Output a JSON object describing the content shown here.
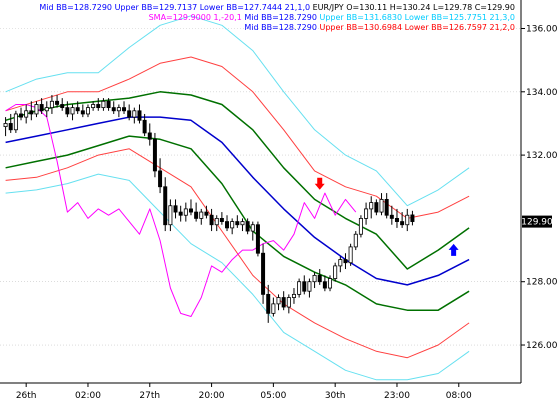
{
  "chart_data": {
    "type": "line",
    "symbol": "EUR/JPY",
    "legend_lines": [
      {
        "text": "Mid BB=128.7290 Upper BB=129.7137 Lower BB=127.7444   21,1,0",
        "color": "#0000ff"
      },
      {
        "text": "EUR/JPY O=130.11 H=130.24 L=129.78 C=129.90",
        "color": "#000000"
      },
      {
        "text": "SMA=129.9000   1,-20,1",
        "color": "#ff00ff"
      },
      {
        "text": "Mid BB=128.7290",
        "color": "#0000ff"
      },
      {
        "text": "Upper BB=131.6830 Lower BB=125.7751   21,3,0",
        "color": "#00ccff"
      },
      {
        "text": "Mid BB=128.7290",
        "color": "#0000ff"
      },
      {
        "text": "Upper BB=130.6984 Lower BB=126.7597   21,2,0",
        "color": "#ff0000"
      }
    ],
    "y_ticks": [
      "136.00",
      "134.00",
      "132.00",
      "128.00",
      "126.00"
    ],
    "ylim": [
      124.8,
      136.9
    ],
    "current_price": "129.90",
    "x_ticks": [
      {
        "label": "26th",
        "i": 4
      },
      {
        "label": "02:00",
        "i": 16
      },
      {
        "label": "27th",
        "i": 28
      },
      {
        "label": "20:00",
        "i": 40
      },
      {
        "label": "05:00",
        "i": 52
      },
      {
        "label": "30th",
        "i": 64
      },
      {
        "label": "23:00",
        "i": 76
      },
      {
        "label": "08:00",
        "i": 88
      }
    ],
    "n_slots": 100,
    "ohlc": [
      {
        "i": 0,
        "o": 132.9,
        "h": 133.2,
        "l": 132.6,
        "c": 133.0
      },
      {
        "i": 1,
        "o": 133.0,
        "h": 133.3,
        "l": 132.7,
        "c": 132.8
      },
      {
        "i": 2,
        "o": 132.8,
        "h": 133.4,
        "l": 132.7,
        "c": 133.3
      },
      {
        "i": 3,
        "o": 133.3,
        "h": 133.5,
        "l": 133.1,
        "c": 133.2
      },
      {
        "i": 4,
        "o": 133.2,
        "h": 133.6,
        "l": 133.0,
        "c": 133.4
      },
      {
        "i": 5,
        "o": 133.4,
        "h": 133.7,
        "l": 133.1,
        "c": 133.3
      },
      {
        "i": 6,
        "o": 133.3,
        "h": 133.7,
        "l": 133.2,
        "c": 133.6
      },
      {
        "i": 7,
        "o": 133.6,
        "h": 133.8,
        "l": 133.3,
        "c": 133.4
      },
      {
        "i": 8,
        "o": 133.4,
        "h": 133.7,
        "l": 133.2,
        "c": 133.5
      },
      {
        "i": 9,
        "o": 133.5,
        "h": 133.9,
        "l": 133.3,
        "c": 133.7
      },
      {
        "i": 10,
        "o": 133.7,
        "h": 133.9,
        "l": 133.5,
        "c": 133.6
      },
      {
        "i": 11,
        "o": 133.6,
        "h": 133.8,
        "l": 133.4,
        "c": 133.5
      },
      {
        "i": 12,
        "o": 133.5,
        "h": 133.7,
        "l": 133.2,
        "c": 133.3
      },
      {
        "i": 13,
        "o": 133.3,
        "h": 133.6,
        "l": 133.1,
        "c": 133.5
      },
      {
        "i": 14,
        "o": 133.5,
        "h": 133.7,
        "l": 133.3,
        "c": 133.4
      },
      {
        "i": 15,
        "o": 133.4,
        "h": 133.6,
        "l": 133.2,
        "c": 133.3
      },
      {
        "i": 16,
        "o": 133.3,
        "h": 133.6,
        "l": 133.2,
        "c": 133.5
      },
      {
        "i": 17,
        "o": 133.5,
        "h": 133.7,
        "l": 133.4,
        "c": 133.6
      },
      {
        "i": 18,
        "o": 133.6,
        "h": 133.8,
        "l": 133.4,
        "c": 133.5
      },
      {
        "i": 19,
        "o": 133.5,
        "h": 133.8,
        "l": 133.4,
        "c": 133.7
      },
      {
        "i": 20,
        "o": 133.7,
        "h": 133.8,
        "l": 133.4,
        "c": 133.5
      },
      {
        "i": 21,
        "o": 133.5,
        "h": 133.7,
        "l": 133.3,
        "c": 133.4
      },
      {
        "i": 22,
        "o": 133.4,
        "h": 133.6,
        "l": 133.2,
        "c": 133.5
      },
      {
        "i": 23,
        "o": 133.5,
        "h": 133.7,
        "l": 133.3,
        "c": 133.4
      },
      {
        "i": 24,
        "o": 133.4,
        "h": 133.6,
        "l": 133.1,
        "c": 133.2
      },
      {
        "i": 25,
        "o": 133.2,
        "h": 133.5,
        "l": 133.0,
        "c": 133.4
      },
      {
        "i": 26,
        "o": 133.4,
        "h": 133.6,
        "l": 133.0,
        "c": 133.1
      },
      {
        "i": 27,
        "o": 133.1,
        "h": 133.3,
        "l": 132.6,
        "c": 132.7
      },
      {
        "i": 28,
        "o": 132.7,
        "h": 133.0,
        "l": 132.3,
        "c": 132.5
      },
      {
        "i": 29,
        "o": 132.5,
        "h": 132.7,
        "l": 131.3,
        "c": 131.5
      },
      {
        "i": 30,
        "o": 131.5,
        "h": 131.9,
        "l": 130.8,
        "c": 131.0
      },
      {
        "i": 31,
        "o": 131.0,
        "h": 131.3,
        "l": 129.6,
        "c": 129.8
      },
      {
        "i": 32,
        "o": 129.8,
        "h": 130.6,
        "l": 129.6,
        "c": 130.4
      },
      {
        "i": 33,
        "o": 130.4,
        "h": 130.6,
        "l": 130.0,
        "c": 130.2
      },
      {
        "i": 34,
        "o": 130.2,
        "h": 130.4,
        "l": 129.9,
        "c": 130.1
      },
      {
        "i": 35,
        "o": 130.1,
        "h": 130.5,
        "l": 129.9,
        "c": 130.3
      },
      {
        "i": 36,
        "o": 130.3,
        "h": 130.6,
        "l": 130.1,
        "c": 130.2
      },
      {
        "i": 37,
        "o": 130.2,
        "h": 130.5,
        "l": 129.9,
        "c": 130.0
      },
      {
        "i": 38,
        "o": 130.0,
        "h": 130.3,
        "l": 129.8,
        "c": 130.2
      },
      {
        "i": 39,
        "o": 130.2,
        "h": 130.4,
        "l": 130.0,
        "c": 130.1
      },
      {
        "i": 40,
        "o": 130.1,
        "h": 130.3,
        "l": 129.6,
        "c": 129.8
      },
      {
        "i": 41,
        "o": 129.8,
        "h": 130.1,
        "l": 129.6,
        "c": 130.0
      },
      {
        "i": 42,
        "o": 130.0,
        "h": 130.2,
        "l": 129.8,
        "c": 129.9
      },
      {
        "i": 43,
        "o": 129.9,
        "h": 130.1,
        "l": 129.6,
        "c": 129.7
      },
      {
        "i": 44,
        "o": 129.7,
        "h": 130.0,
        "l": 129.5,
        "c": 129.9
      },
      {
        "i": 45,
        "o": 129.9,
        "h": 130.1,
        "l": 129.7,
        "c": 129.8
      },
      {
        "i": 46,
        "o": 129.8,
        "h": 130.0,
        "l": 129.6,
        "c": 129.9
      },
      {
        "i": 47,
        "o": 129.9,
        "h": 130.0,
        "l": 129.5,
        "c": 129.6
      },
      {
        "i": 48,
        "o": 129.6,
        "h": 129.9,
        "l": 129.3,
        "c": 129.8
      },
      {
        "i": 49,
        "o": 129.8,
        "h": 129.9,
        "l": 128.8,
        "c": 128.9
      },
      {
        "i": 50,
        "o": 128.9,
        "h": 129.2,
        "l": 127.3,
        "c": 127.6
      },
      {
        "i": 51,
        "o": 127.6,
        "h": 127.9,
        "l": 126.7,
        "c": 127.0
      },
      {
        "i": 52,
        "o": 127.0,
        "h": 127.5,
        "l": 126.9,
        "c": 127.3
      },
      {
        "i": 53,
        "o": 127.3,
        "h": 127.6,
        "l": 127.1,
        "c": 127.5
      },
      {
        "i": 54,
        "o": 127.5,
        "h": 127.7,
        "l": 127.1,
        "c": 127.2
      },
      {
        "i": 55,
        "o": 127.2,
        "h": 127.6,
        "l": 127.0,
        "c": 127.5
      },
      {
        "i": 56,
        "o": 127.5,
        "h": 127.8,
        "l": 127.3,
        "c": 127.6
      },
      {
        "i": 57,
        "o": 127.6,
        "h": 128.1,
        "l": 127.5,
        "c": 128.0
      },
      {
        "i": 58,
        "o": 128.0,
        "h": 128.2,
        "l": 127.6,
        "c": 127.7
      },
      {
        "i": 59,
        "o": 127.7,
        "h": 128.1,
        "l": 127.5,
        "c": 128.0
      },
      {
        "i": 60,
        "o": 128.0,
        "h": 128.3,
        "l": 127.8,
        "c": 128.2
      },
      {
        "i": 61,
        "o": 128.2,
        "h": 128.4,
        "l": 127.9,
        "c": 128.0
      },
      {
        "i": 62,
        "o": 128.0,
        "h": 128.2,
        "l": 127.7,
        "c": 127.8
      },
      {
        "i": 63,
        "o": 127.8,
        "h": 128.2,
        "l": 127.7,
        "c": 128.1
      },
      {
        "i": 64,
        "o": 128.1,
        "h": 128.6,
        "l": 128.0,
        "c": 128.5
      },
      {
        "i": 65,
        "o": 128.5,
        "h": 128.8,
        "l": 128.3,
        "c": 128.7
      },
      {
        "i": 66,
        "o": 128.7,
        "h": 128.9,
        "l": 128.4,
        "c": 128.6
      },
      {
        "i": 67,
        "o": 128.6,
        "h": 129.2,
        "l": 128.5,
        "c": 129.1
      },
      {
        "i": 68,
        "o": 129.1,
        "h": 129.6,
        "l": 129.0,
        "c": 129.5
      },
      {
        "i": 69,
        "o": 129.5,
        "h": 130.1,
        "l": 129.4,
        "c": 130.0
      },
      {
        "i": 70,
        "o": 130.0,
        "h": 130.5,
        "l": 129.8,
        "c": 130.3
      },
      {
        "i": 71,
        "o": 130.3,
        "h": 130.7,
        "l": 130.0,
        "c": 130.5
      },
      {
        "i": 72,
        "o": 130.5,
        "h": 130.6,
        "l": 130.1,
        "c": 130.2
      },
      {
        "i": 73,
        "o": 130.2,
        "h": 130.8,
        "l": 130.1,
        "c": 130.6
      },
      {
        "i": 74,
        "o": 130.6,
        "h": 130.8,
        "l": 130.0,
        "c": 130.1
      },
      {
        "i": 75,
        "o": 130.1,
        "h": 130.4,
        "l": 129.8,
        "c": 130.0
      },
      {
        "i": 76,
        "o": 130.0,
        "h": 130.3,
        "l": 129.7,
        "c": 129.9
      },
      {
        "i": 77,
        "o": 129.9,
        "h": 130.2,
        "l": 129.7,
        "c": 129.8
      },
      {
        "i": 78,
        "o": 129.8,
        "h": 130.3,
        "l": 129.6,
        "c": 130.1
      },
      {
        "i": 79,
        "o": 130.11,
        "h": 130.24,
        "l": 129.78,
        "c": 129.9
      }
    ],
    "sma": [
      {
        "i": 0,
        "v": 133.4
      },
      {
        "i": 2,
        "v": 133.6
      },
      {
        "i": 4,
        "v": 133.6
      },
      {
        "i": 6,
        "v": 133.5
      },
      {
        "i": 8,
        "v": 133.2
      },
      {
        "i": 10,
        "v": 131.8
      },
      {
        "i": 12,
        "v": 130.2
      },
      {
        "i": 14,
        "v": 130.5
      },
      {
        "i": 16,
        "v": 130.0
      },
      {
        "i": 18,
        "v": 130.3
      },
      {
        "i": 20,
        "v": 130.1
      },
      {
        "i": 22,
        "v": 130.3
      },
      {
        "i": 24,
        "v": 129.9
      },
      {
        "i": 26,
        "v": 129.5
      },
      {
        "i": 28,
        "v": 130.3
      },
      {
        "i": 30,
        "v": 129.3
      },
      {
        "i": 32,
        "v": 127.8
      },
      {
        "i": 34,
        "v": 127.0
      },
      {
        "i": 36,
        "v": 126.9
      },
      {
        "i": 38,
        "v": 127.5
      },
      {
        "i": 40,
        "v": 128.5
      },
      {
        "i": 42,
        "v": 128.3
      },
      {
        "i": 44,
        "v": 128.7
      },
      {
        "i": 46,
        "v": 129.0
      },
      {
        "i": 48,
        "v": 129.0
      },
      {
        "i": 50,
        "v": 129.2
      },
      {
        "i": 52,
        "v": 129.3
      },
      {
        "i": 54,
        "v": 129.0
      },
      {
        "i": 56,
        "v": 129.5
      },
      {
        "i": 58,
        "v": 130.5
      },
      {
        "i": 60,
        "v": 130.0
      },
      {
        "i": 62,
        "v": 130.8
      },
      {
        "i": 64,
        "v": 130.1
      },
      {
        "i": 66,
        "v": 130.6
      },
      {
        "i": 68,
        "v": 130.2
      }
    ],
    "mid_bb": [
      {
        "i": 0,
        "v": 132.4
      },
      {
        "i": 6,
        "v": 132.6
      },
      {
        "i": 12,
        "v": 132.8
      },
      {
        "i": 18,
        "v": 133.0
      },
      {
        "i": 24,
        "v": 133.2
      },
      {
        "i": 30,
        "v": 133.2
      },
      {
        "i": 36,
        "v": 133.1
      },
      {
        "i": 42,
        "v": 132.4
      },
      {
        "i": 48,
        "v": 131.3
      },
      {
        "i": 54,
        "v": 130.3
      },
      {
        "i": 60,
        "v": 129.4
      },
      {
        "i": 66,
        "v": 128.7
      },
      {
        "i": 72,
        "v": 128.1
      },
      {
        "i": 78,
        "v": 127.9
      },
      {
        "i": 84,
        "v": 128.2
      },
      {
        "i": 90,
        "v": 128.7
      }
    ],
    "green_upper": [
      {
        "i": 0,
        "v": 133.1
      },
      {
        "i": 6,
        "v": 133.4
      },
      {
        "i": 12,
        "v": 133.6
      },
      {
        "i": 18,
        "v": 133.7
      },
      {
        "i": 24,
        "v": 133.8
      },
      {
        "i": 30,
        "v": 134.0
      },
      {
        "i": 36,
        "v": 133.9
      },
      {
        "i": 42,
        "v": 133.6
      },
      {
        "i": 48,
        "v": 132.8
      },
      {
        "i": 54,
        "v": 131.6
      },
      {
        "i": 60,
        "v": 130.6
      },
      {
        "i": 66,
        "v": 130.0
      },
      {
        "i": 72,
        "v": 129.5
      },
      {
        "i": 78,
        "v": 128.4
      },
      {
        "i": 84,
        "v": 129.0
      },
      {
        "i": 90,
        "v": 129.7
      }
    ],
    "green_lower": [
      {
        "i": 0,
        "v": 131.6
      },
      {
        "i": 6,
        "v": 131.8
      },
      {
        "i": 12,
        "v": 132.0
      },
      {
        "i": 18,
        "v": 132.3
      },
      {
        "i": 24,
        "v": 132.6
      },
      {
        "i": 30,
        "v": 132.5
      },
      {
        "i": 36,
        "v": 132.2
      },
      {
        "i": 42,
        "v": 131.1
      },
      {
        "i": 48,
        "v": 129.6
      },
      {
        "i": 54,
        "v": 128.8
      },
      {
        "i": 60,
        "v": 128.3
      },
      {
        "i": 66,
        "v": 127.9
      },
      {
        "i": 72,
        "v": 127.3
      },
      {
        "i": 78,
        "v": 127.1
      },
      {
        "i": 84,
        "v": 127.1
      },
      {
        "i": 90,
        "v": 127.7
      }
    ],
    "red_upper": [
      {
        "i": 0,
        "v": 133.4
      },
      {
        "i": 6,
        "v": 133.7
      },
      {
        "i": 12,
        "v": 134.0
      },
      {
        "i": 18,
        "v": 134.0
      },
      {
        "i": 24,
        "v": 134.4
      },
      {
        "i": 30,
        "v": 134.9
      },
      {
        "i": 36,
        "v": 135.1
      },
      {
        "i": 42,
        "v": 134.8
      },
      {
        "i": 48,
        "v": 134.0
      },
      {
        "i": 54,
        "v": 132.8
      },
      {
        "i": 60,
        "v": 131.5
      },
      {
        "i": 66,
        "v": 131.0
      },
      {
        "i": 72,
        "v": 130.7
      },
      {
        "i": 78,
        "v": 130.0
      },
      {
        "i": 84,
        "v": 130.2
      },
      {
        "i": 90,
        "v": 130.7
      }
    ],
    "red_lower": [
      {
        "i": 0,
        "v": 131.2
      },
      {
        "i": 6,
        "v": 131.3
      },
      {
        "i": 12,
        "v": 131.6
      },
      {
        "i": 18,
        "v": 132.0
      },
      {
        "i": 24,
        "v": 132.2
      },
      {
        "i": 30,
        "v": 131.6
      },
      {
        "i": 36,
        "v": 131.0
      },
      {
        "i": 42,
        "v": 129.6
      },
      {
        "i": 48,
        "v": 128.2
      },
      {
        "i": 54,
        "v": 127.3
      },
      {
        "i": 60,
        "v": 126.7
      },
      {
        "i": 66,
        "v": 126.2
      },
      {
        "i": 72,
        "v": 125.8
      },
      {
        "i": 78,
        "v": 125.6
      },
      {
        "i": 84,
        "v": 126.0
      },
      {
        "i": 90,
        "v": 126.7
      }
    ],
    "cyan_upper": [
      {
        "i": 0,
        "v": 134.0
      },
      {
        "i": 6,
        "v": 134.4
      },
      {
        "i": 12,
        "v": 134.6
      },
      {
        "i": 18,
        "v": 134.6
      },
      {
        "i": 24,
        "v": 135.4
      },
      {
        "i": 30,
        "v": 136.1
      },
      {
        "i": 36,
        "v": 136.4
      },
      {
        "i": 42,
        "v": 136.1
      },
      {
        "i": 48,
        "v": 135.3
      },
      {
        "i": 54,
        "v": 134.0
      },
      {
        "i": 60,
        "v": 132.8
      },
      {
        "i": 66,
        "v": 132.0
      },
      {
        "i": 72,
        "v": 131.5
      },
      {
        "i": 78,
        "v": 130.4
      },
      {
        "i": 84,
        "v": 130.9
      },
      {
        "i": 90,
        "v": 131.6
      }
    ],
    "cyan_lower": [
      {
        "i": 0,
        "v": 130.8
      },
      {
        "i": 6,
        "v": 130.9
      },
      {
        "i": 12,
        "v": 131.1
      },
      {
        "i": 18,
        "v": 131.4
      },
      {
        "i": 24,
        "v": 131.2
      },
      {
        "i": 30,
        "v": 130.2
      },
      {
        "i": 36,
        "v": 129.2
      },
      {
        "i": 42,
        "v": 128.6
      },
      {
        "i": 48,
        "v": 127.6
      },
      {
        "i": 54,
        "v": 126.4
      },
      {
        "i": 60,
        "v": 125.8
      },
      {
        "i": 66,
        "v": 125.2
      },
      {
        "i": 72,
        "v": 124.9
      },
      {
        "i": 78,
        "v": 124.9
      },
      {
        "i": 84,
        "v": 125.1
      },
      {
        "i": 90,
        "v": 125.8
      }
    ],
    "arrows": [
      {
        "i": 61,
        "v": 131.0,
        "dir": "down",
        "color": "#ff0000"
      },
      {
        "i": 87,
        "v": 129.1,
        "dir": "up",
        "color": "#0000ff"
      }
    ]
  }
}
